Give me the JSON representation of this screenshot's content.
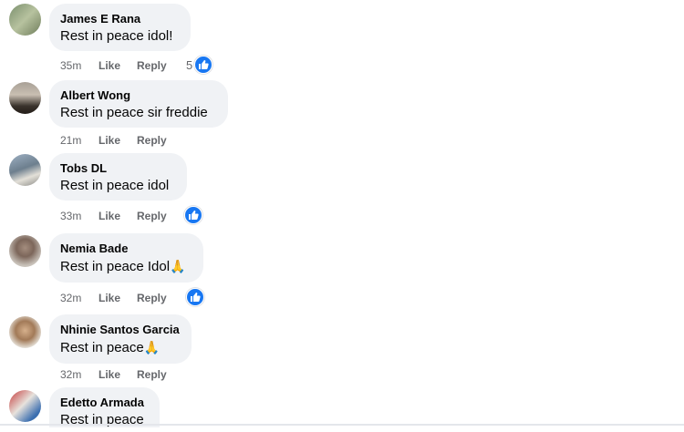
{
  "comments": [
    {
      "author": "James E Rana",
      "text": "Rest in peace idol!",
      "time": "35m",
      "like": "Like",
      "reply": "Reply",
      "reaction_count": "5"
    },
    {
      "author": "Albert Wong",
      "text": "Rest in peace sir freddie",
      "time": "21m",
      "like": "Like",
      "reply": "Reply"
    },
    {
      "author": "Tobs DL",
      "text": "Rest in peace idol",
      "time": "33m",
      "like": "Like",
      "reply": "Reply"
    },
    {
      "author": "Nemia Bade",
      "text": "Rest in peace Idol",
      "emoji": "🙏",
      "time": "32m",
      "like": "Like",
      "reply": "Reply"
    },
    {
      "author": "Nhinie Santos Garcia",
      "text": "Rest in peace",
      "emoji": "🙏",
      "time": "32m",
      "like": "Like",
      "reply": "Reply"
    },
    {
      "author": "Edetto Armada",
      "text": "Rest in peace"
    }
  ],
  "colors": {
    "like_blue": "#1877f2",
    "bubble": "#f0f2f5",
    "meta": "#65676b"
  },
  "icons": {
    "reaction": "thumbs-up-icon",
    "emoji": "praying-hands-emoji"
  }
}
